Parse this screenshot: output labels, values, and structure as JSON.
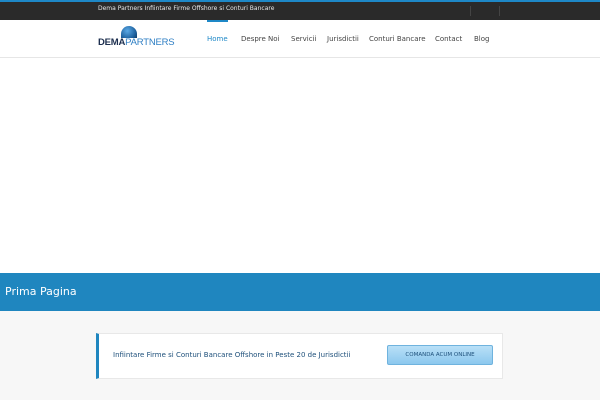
{
  "top_bar": {
    "tagline": "Dema Partners Infiintare Firme Offshore si Conturi Bancare"
  },
  "header": {
    "logo": {
      "part1": "DEMA",
      "part2": "PARTNERS"
    },
    "nav": [
      {
        "label": "Home",
        "active": true
      },
      {
        "label": "Despre Noi",
        "active": false
      },
      {
        "label": "Servicii",
        "active": false
      },
      {
        "label": "Jurisdictii",
        "active": false
      },
      {
        "label": "Conturi Bancare",
        "active": false
      },
      {
        "label": "Contact",
        "active": false
      },
      {
        "label": "Blog",
        "active": false
      }
    ]
  },
  "page_title": "Prima Pagina",
  "cta": {
    "text": "Infiintare Firme si Conturi Bancare Offshore in Peste 20 de Jurisdictii",
    "button_label": "COMANDA ACUM ONLINE"
  },
  "colors": {
    "accent": "#1e88c7",
    "top_bar_bg": "#2a2a2a",
    "title_band_bg": "#1f86bf"
  }
}
